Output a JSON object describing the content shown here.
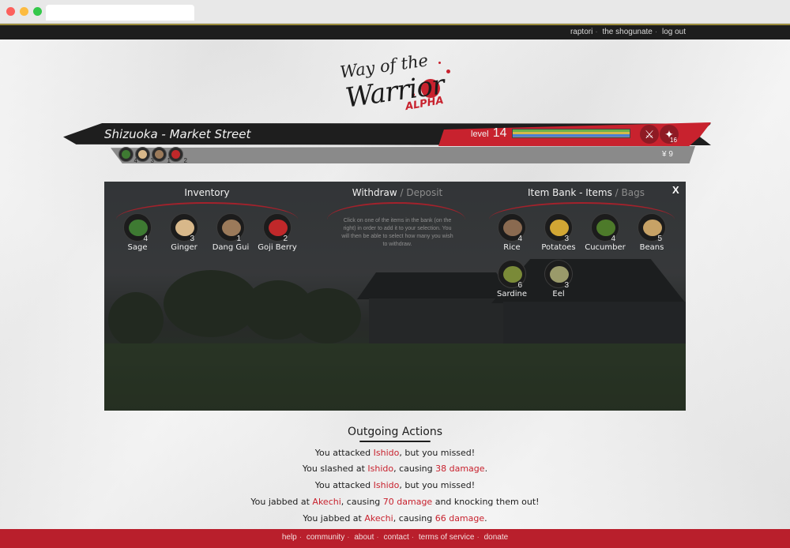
{
  "topnav": {
    "user": "raptori",
    "faction": "the shogunate",
    "logout": "log out"
  },
  "logo": {
    "line1": "Way of the",
    "line2": "Warrior",
    "tag": "ALPHA"
  },
  "location": "Shizuoka - Market Street",
  "player": {
    "level_label": "level",
    "level": "14",
    "hp_fraction": 1.0,
    "stamina_fraction": 1.0,
    "xp_fraction": 1.0,
    "skill_count": "16",
    "yen": "¥ 9"
  },
  "quick_items": [
    {
      "icon": "sage-icon",
      "qty": "4",
      "color": "#3e7a32"
    },
    {
      "icon": "ginger-icon",
      "qty": "3",
      "color": "#d8b88a"
    },
    {
      "icon": "dang-gui-icon",
      "qty": "1",
      "color": "#9b7a5a"
    },
    {
      "icon": "goji-berry-icon",
      "qty": "2",
      "color": "#c0282a"
    }
  ],
  "market": {
    "inventory_title": "Inventory",
    "withdraw_title": "Withdraw",
    "deposit_title": "/ Deposit",
    "bank_title": "Item Bank - Items",
    "bags_title": "/ Bags",
    "close": "X",
    "hint": "Click on one of the items in the bank (on the right) in order to add it to your selection. You will then be able to select how many you wish to withdraw.",
    "inventory": [
      {
        "name": "Sage",
        "qty": "4",
        "color": "#3e7a32"
      },
      {
        "name": "Ginger",
        "qty": "3",
        "color": "#d8b88a"
      },
      {
        "name": "Dang Gui",
        "qty": "1",
        "color": "#9b7a5a"
      },
      {
        "name": "Goji Berry",
        "qty": "2",
        "color": "#c0282a"
      }
    ],
    "bank": [
      {
        "name": "Rice",
        "qty": "4",
        "color": "#8a6a50"
      },
      {
        "name": "Potatoes",
        "qty": "3",
        "color": "#d1a634"
      },
      {
        "name": "Cucumber",
        "qty": "4",
        "color": "#4d7a2a"
      },
      {
        "name": "Beans",
        "qty": "5",
        "color": "#c7a266"
      },
      {
        "name": "Sardine",
        "qty": "6",
        "color": "#7a8a38"
      },
      {
        "name": "Eel",
        "qty": "3",
        "color": "#9a9a6a"
      }
    ]
  },
  "outgoing": {
    "title": "Outgoing Actions",
    "actions": [
      {
        "pre": "You attacked ",
        "target": "Ishido",
        "mid": ", but you missed!",
        "dmg": "",
        "post": ""
      },
      {
        "pre": "You slashed at ",
        "target": "Ishido",
        "mid": ", causing ",
        "dmg": "38 damage",
        "post": "."
      },
      {
        "pre": "You attacked ",
        "target": "Ishido",
        "mid": ", but you missed!",
        "dmg": "",
        "post": ""
      },
      {
        "pre": "You jabbed at ",
        "target": "Akechi",
        "mid": ", causing ",
        "dmg": "70 damage",
        "post": " and knocking them out!"
      },
      {
        "pre": "You jabbed at ",
        "target": "Akechi",
        "mid": ", causing ",
        "dmg": "66 damage",
        "post": "."
      }
    ]
  },
  "footer": [
    "help",
    "community",
    "about",
    "contact",
    "terms of service",
    "donate"
  ],
  "colors": {
    "accent": "#c8222e",
    "dark": "#1d1d1d",
    "footer": "#b91f2c"
  }
}
